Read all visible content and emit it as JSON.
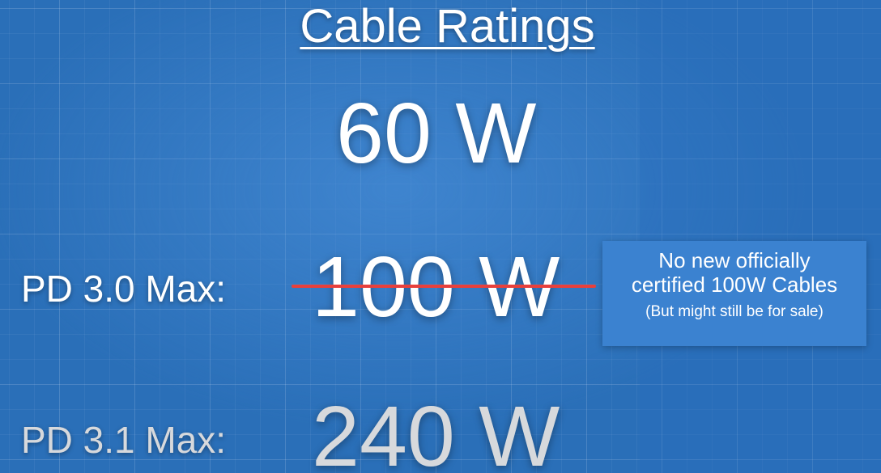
{
  "title": "Cable Ratings",
  "ratings": {
    "base": "60 W",
    "pd30": {
      "label": "PD 3.0 Max:",
      "value": "100 W",
      "strikethrough": true
    },
    "pd31": {
      "label": "PD 3.1 Max:",
      "value": "240 W"
    }
  },
  "note": {
    "line1": "No new officially",
    "line2": "certified 100W Cables",
    "line3": "(But might still be for sale)"
  },
  "colors": {
    "background": "#2a6fb8",
    "strike": "#e8403c",
    "note_box": "#3b82d0"
  }
}
